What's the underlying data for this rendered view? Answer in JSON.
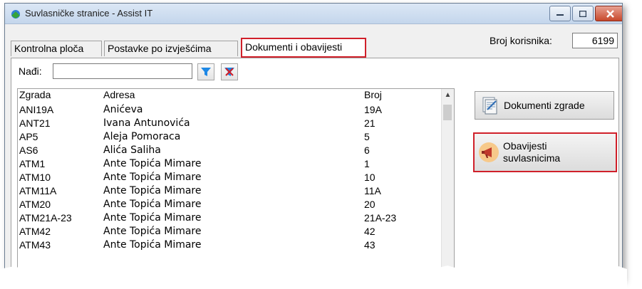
{
  "window": {
    "title": "Suvlasničke stranice - Assist IT"
  },
  "tabs": [
    {
      "label": "Kontrolna ploča"
    },
    {
      "label": "Postavke po izvješćima"
    },
    {
      "label": "Dokumenti i obavijesti"
    }
  ],
  "users": {
    "label": "Broj korisnika:",
    "value": "6199"
  },
  "search": {
    "label": "Nađi:",
    "value": ""
  },
  "table": {
    "headers": [
      "Zgrada",
      "Adresa",
      "Broj"
    ],
    "rows": [
      [
        "ANI19A",
        "Anićeva",
        "19A"
      ],
      [
        "ANT21",
        "Ivana Antunovića",
        "21"
      ],
      [
        "AP5",
        "Aleja Pomoraca",
        "5"
      ],
      [
        "AS6",
        "Alića Saliha",
        "6"
      ],
      [
        "ATM1",
        "Ante Topića Mimare",
        "1"
      ],
      [
        "ATM10",
        "Ante Topića Mimare",
        "10"
      ],
      [
        "ATM11A",
        "Ante Topića Mimare",
        "11A"
      ],
      [
        "ATM20",
        "Ante Topića Mimare",
        "20"
      ],
      [
        "ATM21A-23",
        "Ante Topića Mimare",
        "21A-23"
      ],
      [
        "ATM42",
        "Ante Topića Mimare",
        "42"
      ],
      [
        "ATM43",
        "Ante Topića Mimare",
        "43"
      ]
    ]
  },
  "buttons": {
    "documents": "Dokumenti zgrade",
    "notices_line1": "Obavijesti",
    "notices_line2": "suvlasnicima"
  },
  "colors": {
    "highlight": "#d0202a",
    "filter": "#1e88e5"
  }
}
